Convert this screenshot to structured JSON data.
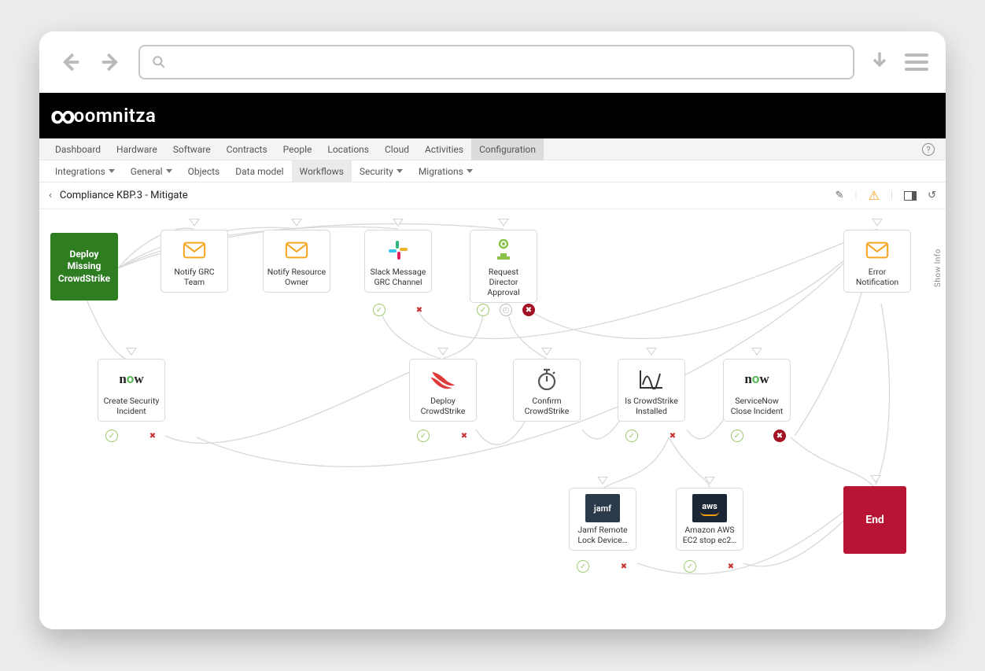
{
  "browser": {
    "search_placeholder": ""
  },
  "app": {
    "brand": "oomnitza",
    "watermark": ""
  },
  "primary_nav": {
    "items": [
      "Dashboard",
      "Hardware",
      "Software",
      "Contracts",
      "People",
      "Locations",
      "Cloud",
      "Activities",
      "Configuration"
    ],
    "active_index": 8
  },
  "secondary_nav": {
    "items": [
      {
        "label": "Integrations",
        "caret": true
      },
      {
        "label": "General",
        "caret": true
      },
      {
        "label": "Objects",
        "caret": false
      },
      {
        "label": "Data model",
        "caret": false
      },
      {
        "label": "Workflows",
        "caret": false
      },
      {
        "label": "Security",
        "caret": true
      },
      {
        "label": "Migrations",
        "caret": true
      }
    ],
    "active_index": 4
  },
  "breadcrumb": {
    "title": "Compliance KBP.3 -  Mitigate"
  },
  "toolbar": {
    "edit_tip": "Edit",
    "warn_tip": "Warning",
    "panel_tip": "Toggle panel",
    "history_tip": "History"
  },
  "side": {
    "show_info": "Show Info"
  },
  "nodes": {
    "start": {
      "label": "Deploy Missing CrowdStrike"
    },
    "notify_grc": {
      "label": "Notify GRC Team"
    },
    "notify_owner": {
      "label": "Notify Resource Owner"
    },
    "slack_grc": {
      "label": "Slack Message GRC Channel"
    },
    "req_director": {
      "label": "Request Director Approval"
    },
    "error_notif": {
      "label": "Error Notification"
    },
    "create_incident": {
      "label": "Create Security Incident"
    },
    "deploy_cs": {
      "label": "Deploy CrowdStrike"
    },
    "confirm_cs": {
      "label": "Confirm CrowdStrike"
    },
    "is_installed": {
      "label": "Is CrowdStrike Installed"
    },
    "sn_close": {
      "label": "ServiceNow Close Incident"
    },
    "jamf_lock": {
      "label": "Jamf Remote Lock Device…"
    },
    "aws_stop": {
      "label": "Amazon AWS EC2 stop ec2…"
    },
    "end": {
      "label": "End"
    }
  },
  "icons": {
    "now": "now",
    "jamf": "jamf",
    "aws": "aws"
  }
}
